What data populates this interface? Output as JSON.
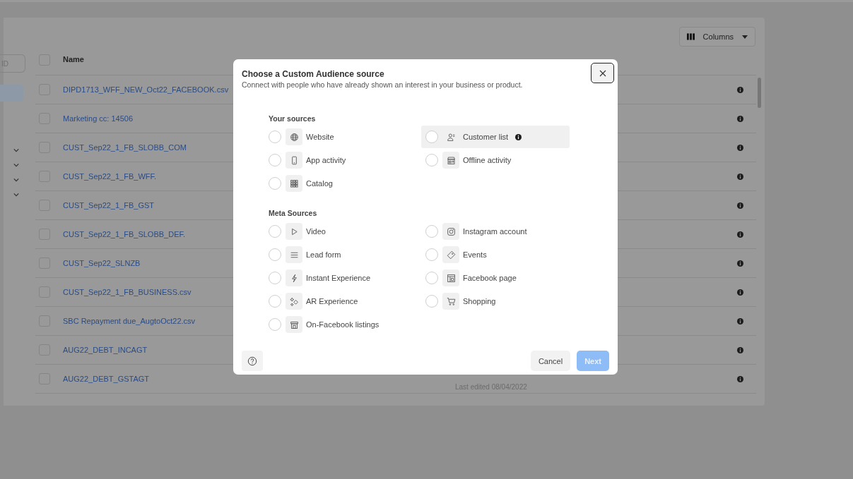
{
  "filter": {
    "placeholder": "ID"
  },
  "columns_button": {
    "label": "Columns"
  },
  "table": {
    "all_checked": false,
    "columns": [
      {
        "label": "Name"
      }
    ],
    "rows": [
      {
        "name": "DIPD1713_WFF_NEW_Oct22_FACEBOOK.csv",
        "checked": false
      },
      {
        "name": "Marketing cc: 14506",
        "checked": false
      },
      {
        "name": "CUST_Sep22_1_FB_SLOBB_COM",
        "checked": false
      },
      {
        "name": "CUST_Sep22_1_FB_WFF.",
        "checked": false
      },
      {
        "name": "CUST_Sep22_1_FB_GST",
        "checked": false
      },
      {
        "name": "CUST_Sep22_1_FB_SLOBB_DEF.",
        "checked": false
      },
      {
        "name": "CUST_Sep22_SLNZB",
        "checked": false
      },
      {
        "name": "CUST_Sep22_1_FB_BUSINESS.csv",
        "checked": false
      },
      {
        "name": "SBC Repayment due_AugtoOct22.csv",
        "checked": false
      },
      {
        "name": "AUG22_DEBT_INCAGT",
        "checked": false
      },
      {
        "name": "AUG22_DEBT_GSTAGT",
        "checked": false,
        "column_2": "Last edited 08/04/2022"
      }
    ]
  },
  "dialog": {
    "title": "Choose a Custom Audience source",
    "subtitle": "Connect with people who have already shown an interest in your business or product.",
    "sections": [
      {
        "heading": "Your sources",
        "options": [
          {
            "label": "Website",
            "selected": false,
            "hovered": false,
            "info": false
          },
          {
            "label": "Customer list",
            "selected": false,
            "hovered": true,
            "info": true
          },
          {
            "label": "App activity",
            "selected": false,
            "hovered": false,
            "info": false
          },
          {
            "label": "Offline activity",
            "selected": false,
            "hovered": false,
            "info": false
          },
          {
            "label": "Catalog",
            "selected": false,
            "hovered": false,
            "info": false
          }
        ]
      },
      {
        "heading": "Meta Sources",
        "options": [
          {
            "label": "Video",
            "selected": false,
            "hovered": false,
            "info": false
          },
          {
            "label": "Instagram account",
            "selected": false,
            "hovered": false,
            "info": false
          },
          {
            "label": "Lead form",
            "selected": false,
            "hovered": false,
            "info": false
          },
          {
            "label": "Events",
            "selected": false,
            "hovered": false,
            "info": false
          },
          {
            "label": "Instant Experience",
            "selected": false,
            "hovered": false,
            "info": false
          },
          {
            "label": "Facebook page",
            "selected": false,
            "hovered": false,
            "info": false
          },
          {
            "label": "AR Experience",
            "selected": false,
            "hovered": false,
            "info": false
          },
          {
            "label": "Shopping",
            "selected": false,
            "hovered": false,
            "info": false
          },
          {
            "label": "On-Facebook listings",
            "selected": false,
            "hovered": false,
            "info": false
          }
        ]
      }
    ],
    "cancel": {
      "label": "Cancel"
    },
    "next": {
      "label": "Next",
      "disabled": true
    }
  }
}
